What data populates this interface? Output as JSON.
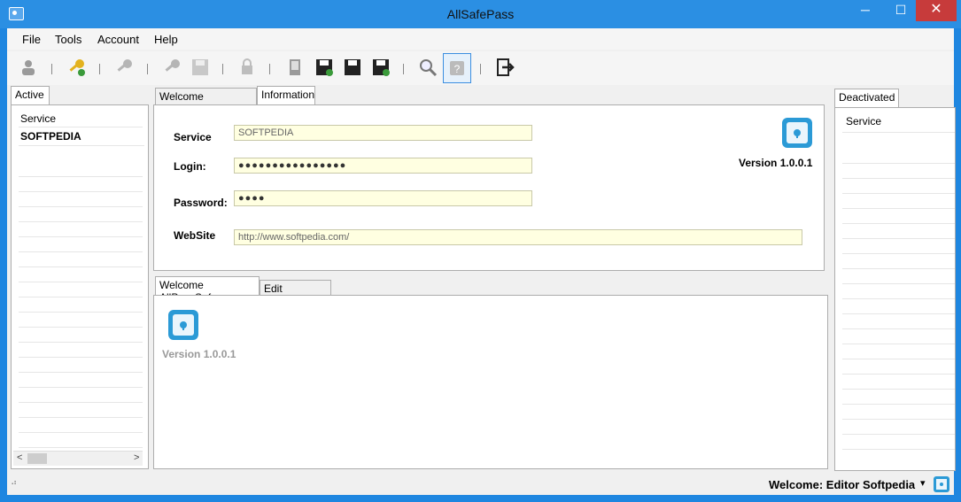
{
  "window": {
    "title": "AllSafePass",
    "min_glyph": "─",
    "max_glyph": "☐",
    "close_glyph": "✕"
  },
  "menu": [
    "File",
    "Tools",
    "Account",
    "Help"
  ],
  "toolbar": [
    "add-user-icon",
    "add-key-icon",
    "remove-key-icon",
    "search-key-icon",
    "save-disabled-icon",
    "lock-icon",
    "bookmark-icon",
    "save-add-icon",
    "save-icon",
    "save-export-icon",
    "magnifier-icon",
    "help-icon",
    "exit-icon"
  ],
  "left_panel": {
    "tab": "Active",
    "header": "Service",
    "items": [
      "SOFTPEDIA"
    ]
  },
  "right_panel": {
    "tab": "Deactivated",
    "header": "Service"
  },
  "top_tabs": [
    "Welcome AllPassSafe",
    "Information"
  ],
  "info": {
    "service_label": "Service",
    "service_value": "SOFTPEDIA",
    "login_label": "Login:",
    "login_value": "●●●●●●●●●●●●●●●●",
    "password_label": "Password:",
    "password_value": "●●●●",
    "website_label": "WebSite",
    "website_value": "http://www.softpedia.com/",
    "version": "Version 1.0.0.1"
  },
  "bottom_tabs": [
    "Welcome AllPassSafe",
    "Edit Information"
  ],
  "bottom": {
    "version": "Version 1.0.0.1"
  },
  "status": {
    "user": "Welcome: Editor Softpedia",
    "dropdown": "▾",
    "grip": "⠴"
  },
  "colors": {
    "field_bg": "#ffffe1",
    "safe_blue": "#2b9ad6"
  }
}
